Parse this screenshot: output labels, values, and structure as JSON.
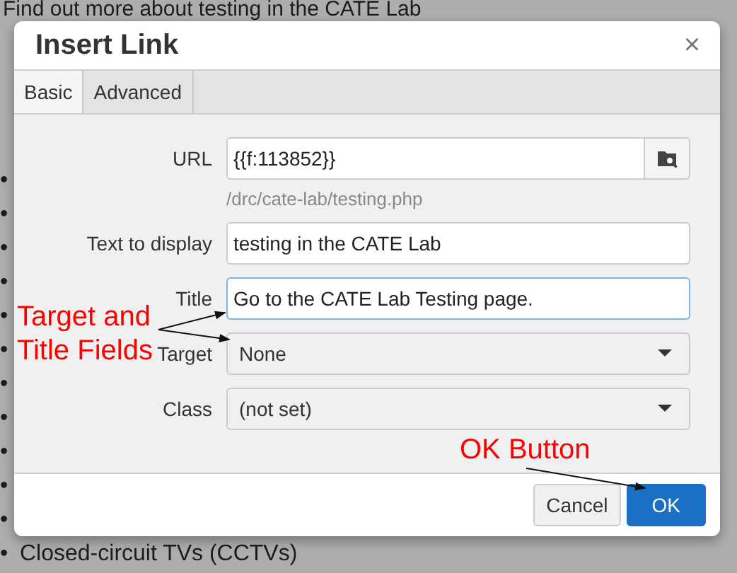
{
  "background": {
    "intro": "Find out more about testing in the CATE Lab",
    "list": [
      {
        "bullet": "•"
      },
      {
        "bullet": "•"
      },
      {
        "bullet": "•"
      },
      {
        "bullet": "•"
      },
      {
        "bullet": "•"
      },
      {
        "bullet": "•"
      },
      {
        "bullet": "•"
      },
      {
        "bullet": "•"
      },
      {
        "bullet": "•"
      },
      {
        "bullet": "•"
      },
      {
        "bullet": "•"
      },
      {
        "bullet": "•",
        "text": "Closed-circuit TVs (CCTVs)"
      }
    ]
  },
  "dialog": {
    "title": "Insert Link",
    "close": "×",
    "tabs": [
      {
        "label": "Basic",
        "selected": true
      },
      {
        "label": "Advanced",
        "selected": false
      }
    ],
    "fields": [
      {
        "label": "URL",
        "kind": "browse",
        "value": "{{f:113852}}",
        "hint": "/drc/cate-lab/testing.php",
        "focused": false
      },
      {
        "label": "Text to display",
        "kind": "text",
        "value": "testing in the CATE Lab",
        "focused": false
      },
      {
        "label": "Title",
        "kind": "text",
        "value": "Go to the CATE Lab Testing page.",
        "focused": true
      },
      {
        "label": "Target",
        "kind": "select",
        "value": "None",
        "focused": false
      },
      {
        "label": "Class",
        "kind": "select",
        "value": "(not set)",
        "focused": false
      }
    ],
    "buttons": [
      {
        "label": "Cancel",
        "primary": false
      },
      {
        "label": "OK",
        "primary": true
      }
    ]
  },
  "annotations": [
    {
      "text": "Target and Title Fields"
    },
    {
      "text": "OK Button"
    }
  ]
}
